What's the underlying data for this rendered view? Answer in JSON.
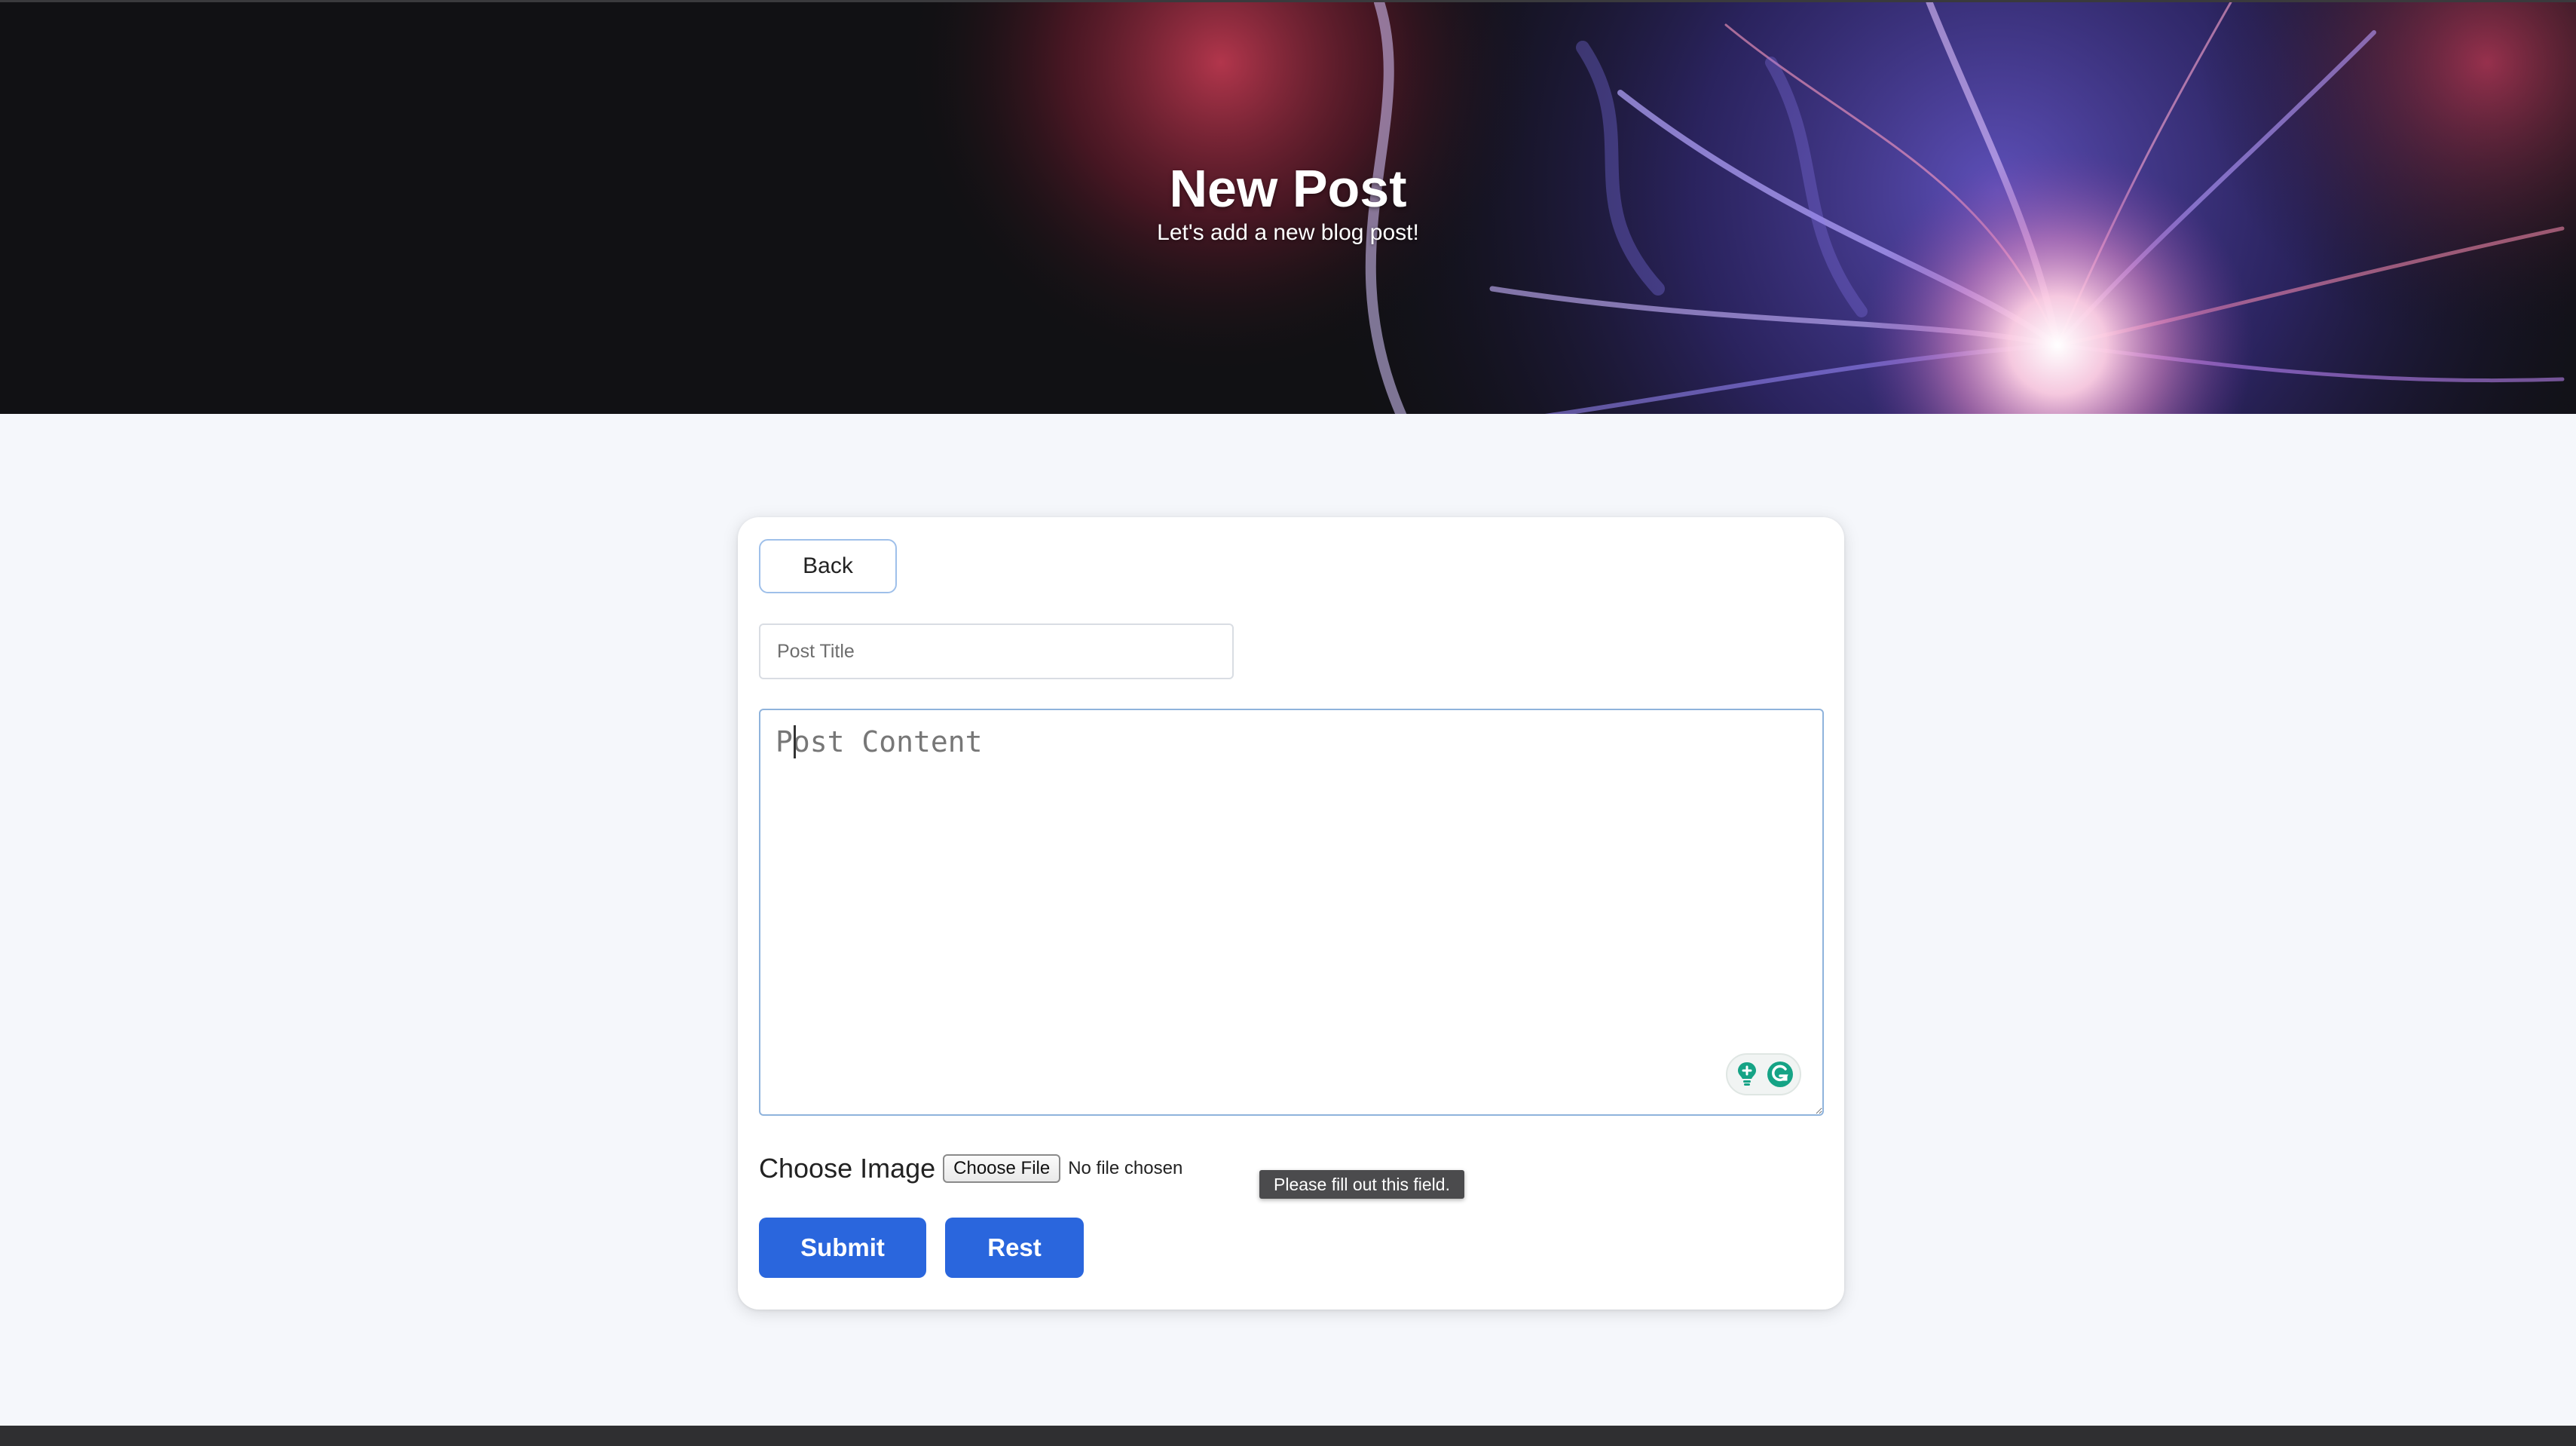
{
  "hero": {
    "title": "New Post",
    "subtitle": "Let's add a new blog post!"
  },
  "form": {
    "back_label": "Back",
    "post_title": {
      "value": "",
      "placeholder": "Post Title"
    },
    "post_content": {
      "value": "",
      "placeholder": "Post Content"
    },
    "image_label": "Choose Image",
    "file_button_label": "Choose File",
    "file_status": "No file chosen",
    "submit_label": "Submit",
    "reset_label": "Rest"
  },
  "validation_tooltip": "Please fill out this field.",
  "icons": {
    "grammarly_assist": "lightbulb-plus-icon",
    "grammarly_logo": "grammarly-g-icon"
  },
  "colors": {
    "primary_button": "#2a66dd",
    "back_border": "#9fc0ea",
    "page_background": "#f5f7fb",
    "hero_background": "#111114",
    "grammarly_green": "#15c39a"
  }
}
